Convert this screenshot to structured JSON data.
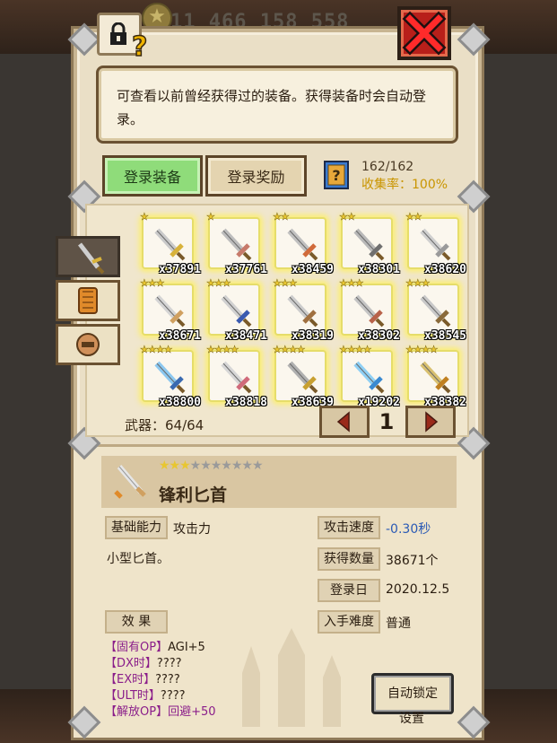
{
  "top_bar": {
    "gold_readout": "11 466 158 558"
  },
  "info": {
    "description": "可查看以前曾经获得过的装备。获得装备时会自动登录。"
  },
  "tabs": [
    {
      "label": "登录装备",
      "active": true
    },
    {
      "label": "登录奖励",
      "active": false
    }
  ],
  "collection": {
    "count": "162/162",
    "rate": "收集率：100%"
  },
  "categories": [
    {
      "icon": "sword-icon",
      "active": true
    },
    {
      "icon": "armor-icon",
      "active": false
    },
    {
      "icon": "helmet-icon",
      "active": false
    }
  ],
  "items": [
    {
      "stars": "★",
      "count": "x37891",
      "blade": "#c9c9c9",
      "guard": "#d8b23a"
    },
    {
      "stars": "★",
      "count": "x37761",
      "blade": "#bdbdbd",
      "guard": "#c77a6a"
    },
    {
      "stars": "★★",
      "count": "x38459",
      "blade": "#c0c0c0",
      "guard": "#d06a3a"
    },
    {
      "stars": "★★",
      "count": "x38301",
      "blade": "#b8b8b8",
      "guard": "#6f6f6f"
    },
    {
      "stars": "★★",
      "count": "x38620",
      "blade": "#cfcfcf",
      "guard": "#9a9a9a"
    },
    {
      "stars": "★★★",
      "count": "x38671",
      "blade": "#d4d4d4",
      "guard": "#d0a060"
    },
    {
      "stars": "★★★",
      "count": "x38471",
      "blade": "#d0d0d0",
      "guard": "#3a5ab0"
    },
    {
      "stars": "★★★",
      "count": "x38319",
      "blade": "#cccccc",
      "guard": "#a07040"
    },
    {
      "stars": "★★★",
      "count": "x38302",
      "blade": "#c4c4c4",
      "guard": "#b8624a"
    },
    {
      "stars": "★★★",
      "count": "x38545",
      "blade": "#c8c8c8",
      "guard": "#8a6a3a"
    },
    {
      "stars": "★★★★",
      "count": "x38800",
      "blade": "#8cc8f0",
      "guard": "#3a6ab0"
    },
    {
      "stars": "★★★★",
      "count": "x38818",
      "blade": "#d6d6d6",
      "guard": "#d06a7a"
    },
    {
      "stars": "★★★★",
      "count": "x38639",
      "blade": "#b0b0b0",
      "guard": "#c8a030"
    },
    {
      "stars": "★★★★",
      "count": "x19202",
      "blade": "#8fd0f5",
      "guard": "#3a8ad0"
    },
    {
      "stars": "★★★★",
      "count": "x38382",
      "blade": "#d8c070",
      "guard": "#c08020"
    }
  ],
  "list_footer": {
    "weapon_label": "武器：64/64",
    "page": "1",
    "prev_icon": "arrow-left-icon",
    "next_icon": "arrow-right-icon"
  },
  "detail": {
    "name": "锋利匕首",
    "stars_filled": "★★★",
    "stars_empty": "★★★★★★★",
    "basic_label": "基础能力",
    "basic_value": "攻击力",
    "description": "小型匕首。",
    "speed_label": "攻击速度",
    "speed_value": "-0.30秒",
    "count_label": "获得数量",
    "count_value": "38671个",
    "date_label": "登录日",
    "date_value": "2020.12.5",
    "difficulty_label": "入手难度",
    "difficulty_value": "普通",
    "effect_label": "效 果",
    "effects": [
      {
        "tag": "【固有OP】",
        "value": "AGI+5"
      },
      {
        "tag": "【DX时】",
        "value": "????"
      },
      {
        "tag": "【EX时】",
        "value": "????"
      },
      {
        "tag": "【ULT时】",
        "value": "????"
      },
      {
        "tag": "【解放OP】",
        "value": "回避+50"
      }
    ]
  },
  "autolock": {
    "line1": "自动锁定",
    "line2": "设置"
  },
  "colors": {
    "active_tab": "#8fdc7a",
    "rate_gold": "#c99500",
    "close_red": "#b81f1a",
    "item_glow": "#f5e84a"
  }
}
